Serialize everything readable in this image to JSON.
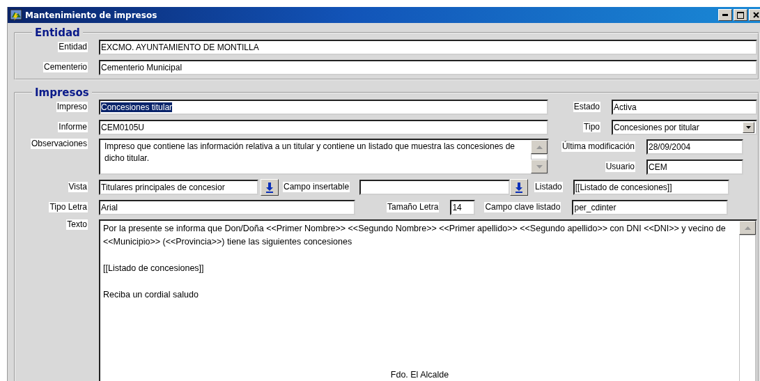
{
  "window": {
    "title": "Mantenimiento de impresos"
  },
  "entidad": {
    "legend": "Entidad",
    "fields": [
      {
        "label": "Entidad",
        "value": "EXCMO. AYUNTAMIENTO DE MONTILLA"
      },
      {
        "label": "Cementerio",
        "value": "Cementerio Municipal"
      }
    ]
  },
  "impresos": {
    "legend": "Impresos",
    "impreso": {
      "label": "Impreso",
      "value": "Concesiones titular",
      "highlighted": true
    },
    "estado": {
      "label": "Estado",
      "value": "Activa"
    },
    "informe": {
      "label": "Informe",
      "value": "CEM0105U"
    },
    "tipo": {
      "label": "Tipo",
      "value": "Concesiones por titular"
    },
    "observaciones": {
      "label": "Observaciones",
      "value": "Impreso que contiene las información relativa a un titular y contiene un listado que muestra las concesiones de dicho titular."
    },
    "ultima_modificacion": {
      "label": "Última modificación",
      "value": "28/09/2004"
    },
    "usuario": {
      "label": "Usuario",
      "value": "CEM"
    },
    "vista": {
      "label": "Vista",
      "value": "Titulares principales de concesior"
    },
    "campo_insertable": {
      "label": "Campo insertable"
    },
    "listado": {
      "label": "Listado",
      "value": "[[Listado de concesiones]]"
    },
    "tipo_letra": {
      "label": "Tipo Letra",
      "value": "Arial"
    },
    "tamano_letra": {
      "label": "Tamaño Letra",
      "value": "14"
    },
    "campo_clave_listado": {
      "label": "Campo clave listado",
      "value": "per_cdinter"
    },
    "texto": {
      "label": "Texto",
      "paragraphs": [
        {
          "kind": "body",
          "text": "Por la presente se informa que Don/Doña <<Primer Nombre>> <<Segundo Nombre>> <<Primer apellido>> <<Segundo apellido>> con DNI <<DNI>> y vecino de <<Municipio>> (<<Provincia>>) tiene las siguientes concesiones"
        },
        {
          "kind": "body",
          "text": "[[Listado de concesiones]]"
        },
        {
          "kind": "closing",
          "text": "Reciba un cordial saludo"
        },
        {
          "kind": "signature",
          "text": "Fdo. El Alcalde"
        }
      ]
    }
  }
}
